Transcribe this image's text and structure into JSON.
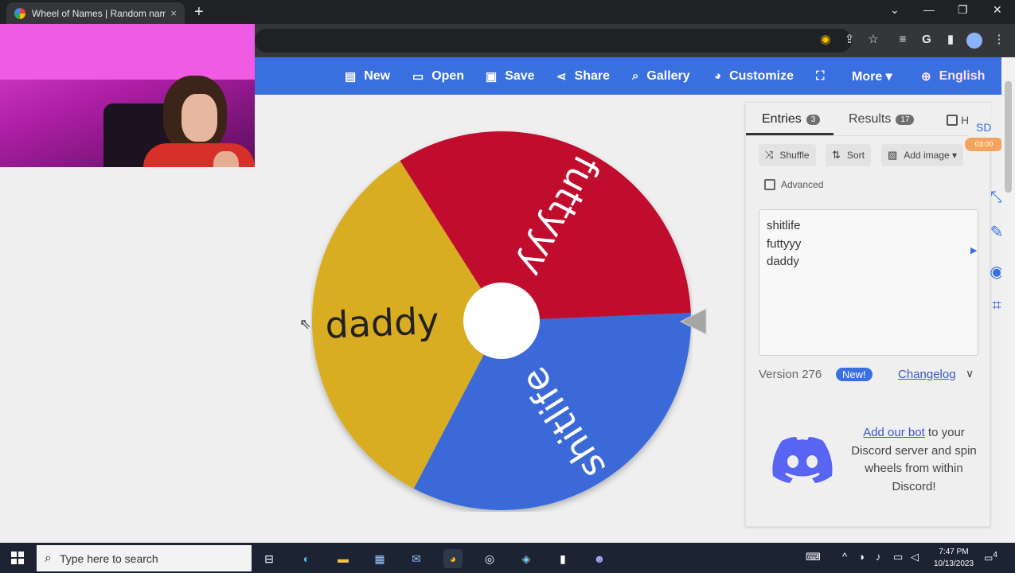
{
  "browser": {
    "tab_title": "Wheel of Names | Random nam",
    "tab_close": "×",
    "new_tab": "+",
    "window_controls": [
      "⌄",
      "—",
      "❐",
      "✕"
    ]
  },
  "header": {
    "nav": [
      {
        "icon": "file-icon",
        "glyph": "▤",
        "label": "New"
      },
      {
        "icon": "folder-open-icon",
        "glyph": "▭",
        "label": "Open"
      },
      {
        "icon": "save-icon",
        "glyph": "▣",
        "label": "Save"
      },
      {
        "icon": "share-icon",
        "glyph": "⋖",
        "label": "Share"
      },
      {
        "icon": "search-icon",
        "glyph": "⌕",
        "label": "Gallery"
      },
      {
        "icon": "palette-icon",
        "glyph": "◕",
        "label": "Customize"
      },
      {
        "icon": "fullscreen-icon",
        "glyph": "⛶",
        "label": ""
      },
      {
        "icon": "chevron-down-icon",
        "glyph": "",
        "label": "More ▾"
      },
      {
        "icon": "globe-icon",
        "glyph": "⊕",
        "label": "English"
      }
    ]
  },
  "wheel": {
    "segments": [
      {
        "label": "futtyyy",
        "color": "#c0082f",
        "text_color": "#ffffff"
      },
      {
        "label": "shitlife",
        "color": "#3a6bd8",
        "text_color": "#ffffff"
      },
      {
        "label": "daddy",
        "color": "#d9ad22",
        "text_color": "#222222"
      }
    ],
    "center_color": "#ffffff",
    "pointer_color": "#a6a6a6"
  },
  "sidebar": {
    "tabs": [
      {
        "label": "Entries",
        "count": "3",
        "active": true
      },
      {
        "label": "Results",
        "count": "17",
        "active": false
      }
    ],
    "hide_label": "H",
    "tools": [
      {
        "icon": "shuffle-icon",
        "glyph": "⤨",
        "label": "Shuffle"
      },
      {
        "icon": "sort-icon",
        "glyph": "⇅",
        "label": "Sort"
      },
      {
        "icon": "image-icon",
        "glyph": "▨",
        "label": "Add image ▾"
      }
    ],
    "advanced_label": "Advanced",
    "entries": [
      "shitlife",
      "futtyyy",
      "daddy"
    ],
    "version": "Version 276",
    "new_badge": "New!",
    "changelog": "Changelog",
    "discord": {
      "link_text": "Add our bot",
      "rest_text": " to your Discord server and spin wheels from within Discord!"
    }
  },
  "side_badge": {
    "initials": "SD",
    "time": "03:00"
  },
  "taskbar": {
    "search_placeholder": "Type here to search",
    "time": "7:47 PM",
    "date": "10/13/2023",
    "notifications": "4"
  }
}
